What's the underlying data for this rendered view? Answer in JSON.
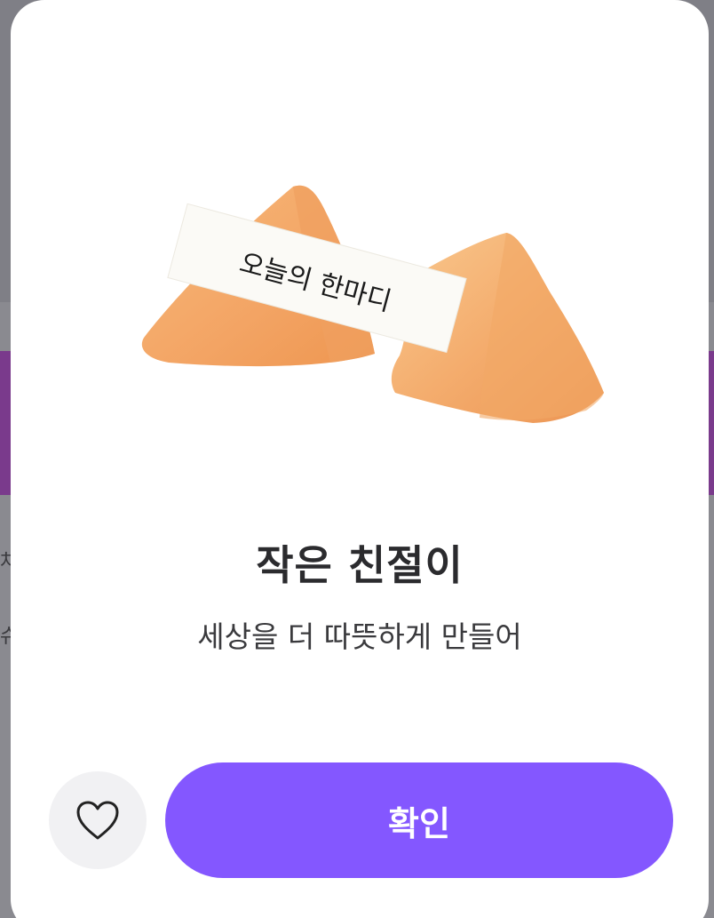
{
  "background": {
    "text_1": "차",
    "text_2": "슈"
  },
  "fortune_card": {
    "paper_text": "오늘의 한마디",
    "title": "작은 친절이",
    "subtitle": "세상을 더 따뜻하게 만들어"
  },
  "actions": {
    "like_icon": "heart-outline-icon",
    "confirm_label": "확인"
  },
  "colors": {
    "accent": "#8457ff",
    "like_bg": "#f1f1f3",
    "cookie": "#f3a868"
  }
}
